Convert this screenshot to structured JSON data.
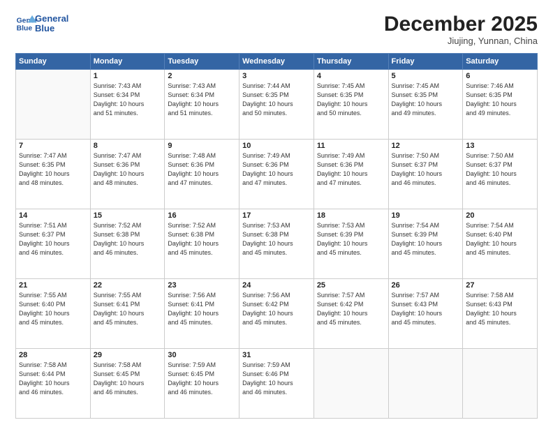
{
  "header": {
    "logo_line1": "General",
    "logo_line2": "Blue",
    "month": "December 2025",
    "location": "Jiujing, Yunnan, China"
  },
  "weekdays": [
    "Sunday",
    "Monday",
    "Tuesday",
    "Wednesday",
    "Thursday",
    "Friday",
    "Saturday"
  ],
  "weeks": [
    [
      {
        "day": "",
        "info": ""
      },
      {
        "day": "1",
        "info": "Sunrise: 7:43 AM\nSunset: 6:34 PM\nDaylight: 10 hours\nand 51 minutes."
      },
      {
        "day": "2",
        "info": "Sunrise: 7:43 AM\nSunset: 6:34 PM\nDaylight: 10 hours\nand 51 minutes."
      },
      {
        "day": "3",
        "info": "Sunrise: 7:44 AM\nSunset: 6:35 PM\nDaylight: 10 hours\nand 50 minutes."
      },
      {
        "day": "4",
        "info": "Sunrise: 7:45 AM\nSunset: 6:35 PM\nDaylight: 10 hours\nand 50 minutes."
      },
      {
        "day": "5",
        "info": "Sunrise: 7:45 AM\nSunset: 6:35 PM\nDaylight: 10 hours\nand 49 minutes."
      },
      {
        "day": "6",
        "info": "Sunrise: 7:46 AM\nSunset: 6:35 PM\nDaylight: 10 hours\nand 49 minutes."
      }
    ],
    [
      {
        "day": "7",
        "info": "Sunrise: 7:47 AM\nSunset: 6:35 PM\nDaylight: 10 hours\nand 48 minutes."
      },
      {
        "day": "8",
        "info": "Sunrise: 7:47 AM\nSunset: 6:36 PM\nDaylight: 10 hours\nand 48 minutes."
      },
      {
        "day": "9",
        "info": "Sunrise: 7:48 AM\nSunset: 6:36 PM\nDaylight: 10 hours\nand 47 minutes."
      },
      {
        "day": "10",
        "info": "Sunrise: 7:49 AM\nSunset: 6:36 PM\nDaylight: 10 hours\nand 47 minutes."
      },
      {
        "day": "11",
        "info": "Sunrise: 7:49 AM\nSunset: 6:36 PM\nDaylight: 10 hours\nand 47 minutes."
      },
      {
        "day": "12",
        "info": "Sunrise: 7:50 AM\nSunset: 6:37 PM\nDaylight: 10 hours\nand 46 minutes."
      },
      {
        "day": "13",
        "info": "Sunrise: 7:50 AM\nSunset: 6:37 PM\nDaylight: 10 hours\nand 46 minutes."
      }
    ],
    [
      {
        "day": "14",
        "info": "Sunrise: 7:51 AM\nSunset: 6:37 PM\nDaylight: 10 hours\nand 46 minutes."
      },
      {
        "day": "15",
        "info": "Sunrise: 7:52 AM\nSunset: 6:38 PM\nDaylight: 10 hours\nand 46 minutes."
      },
      {
        "day": "16",
        "info": "Sunrise: 7:52 AM\nSunset: 6:38 PM\nDaylight: 10 hours\nand 45 minutes."
      },
      {
        "day": "17",
        "info": "Sunrise: 7:53 AM\nSunset: 6:38 PM\nDaylight: 10 hours\nand 45 minutes."
      },
      {
        "day": "18",
        "info": "Sunrise: 7:53 AM\nSunset: 6:39 PM\nDaylight: 10 hours\nand 45 minutes."
      },
      {
        "day": "19",
        "info": "Sunrise: 7:54 AM\nSunset: 6:39 PM\nDaylight: 10 hours\nand 45 minutes."
      },
      {
        "day": "20",
        "info": "Sunrise: 7:54 AM\nSunset: 6:40 PM\nDaylight: 10 hours\nand 45 minutes."
      }
    ],
    [
      {
        "day": "21",
        "info": "Sunrise: 7:55 AM\nSunset: 6:40 PM\nDaylight: 10 hours\nand 45 minutes."
      },
      {
        "day": "22",
        "info": "Sunrise: 7:55 AM\nSunset: 6:41 PM\nDaylight: 10 hours\nand 45 minutes."
      },
      {
        "day": "23",
        "info": "Sunrise: 7:56 AM\nSunset: 6:41 PM\nDaylight: 10 hours\nand 45 minutes."
      },
      {
        "day": "24",
        "info": "Sunrise: 7:56 AM\nSunset: 6:42 PM\nDaylight: 10 hours\nand 45 minutes."
      },
      {
        "day": "25",
        "info": "Sunrise: 7:57 AM\nSunset: 6:42 PM\nDaylight: 10 hours\nand 45 minutes."
      },
      {
        "day": "26",
        "info": "Sunrise: 7:57 AM\nSunset: 6:43 PM\nDaylight: 10 hours\nand 45 minutes."
      },
      {
        "day": "27",
        "info": "Sunrise: 7:58 AM\nSunset: 6:43 PM\nDaylight: 10 hours\nand 45 minutes."
      }
    ],
    [
      {
        "day": "28",
        "info": "Sunrise: 7:58 AM\nSunset: 6:44 PM\nDaylight: 10 hours\nand 46 minutes."
      },
      {
        "day": "29",
        "info": "Sunrise: 7:58 AM\nSunset: 6:45 PM\nDaylight: 10 hours\nand 46 minutes."
      },
      {
        "day": "30",
        "info": "Sunrise: 7:59 AM\nSunset: 6:45 PM\nDaylight: 10 hours\nand 46 minutes."
      },
      {
        "day": "31",
        "info": "Sunrise: 7:59 AM\nSunset: 6:46 PM\nDaylight: 10 hours\nand 46 minutes."
      },
      {
        "day": "",
        "info": ""
      },
      {
        "day": "",
        "info": ""
      },
      {
        "day": "",
        "info": ""
      }
    ]
  ]
}
